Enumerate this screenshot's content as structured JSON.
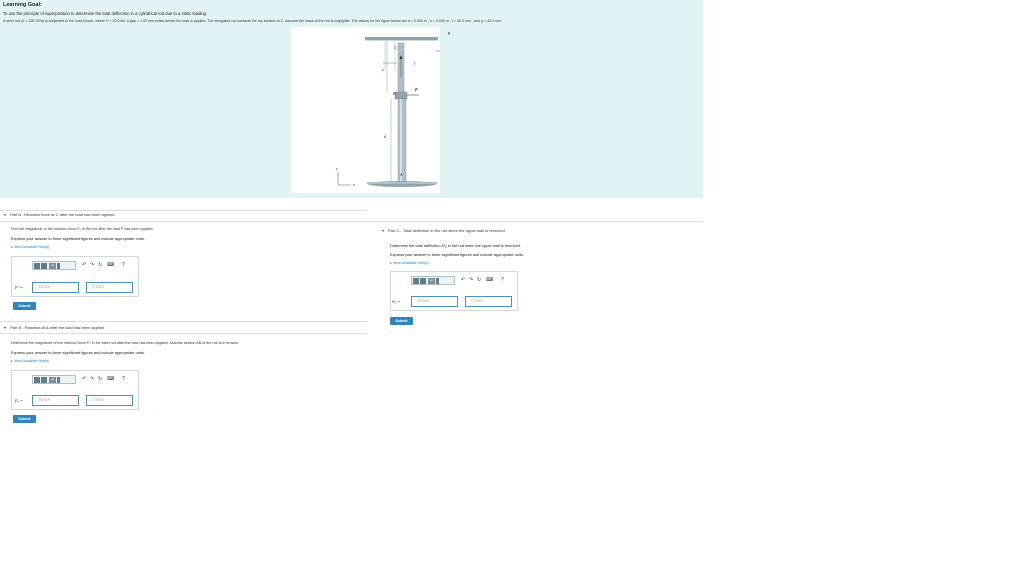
{
  "goal": {
    "title": "Learning Goal:",
    "text": "To use the principle of superposition to determine the total deflection in a cylindrical rod due to a static loading.",
    "problem_a": "A steel rod (",
    "problem_e": "E",
    "problem_b": " = 200 GPa) is subjected to the load shown, where ",
    "problem_P": "P",
    "problem_c": " = 20.0 kN. A gap ",
    "problem_d": " = 1.00 mm exists before the load is applied. The elongated rod contacts the top surface at C. Assume the mass of the rod is negligible. The values for the figure below are ",
    "problem_vals": "d = 0.900 m , e = 0.200 m , f = 50.0 mm , and g = 40.0 mm."
  },
  "figure": {
    "labels": {
      "C": "C",
      "e": "e",
      "f": "f",
      "g": "g",
      "B": "B",
      "P": "P",
      "d": "d",
      "A": "A",
      "y": "y",
      "x": "x"
    }
  },
  "partA": {
    "header": "Part A - Reaction force at C after the load has been applied",
    "question": "Find the magnitude of the reaction force Fₙ in the rod after the load P has been applied.",
    "express": "Express your answer to three significant figures and include appropriate units.",
    "hint": "View Available Hint(s)",
    "var_label": "Fᶜ =",
    "value_placeholder": "Value",
    "units_placeholder": "Units",
    "submit": "Submit"
  },
  "partB": {
    "header": "Part B - Reaction at A after the load has been applied",
    "question": "Determine the magnitude of the reaction force Fₐ in the steel rod after the load has been applied. Assume section AB of the rod is in tension.",
    "express": "Express your answer to three significant figures and include appropriate units.",
    "hint": "View Available Hint(s)",
    "var_label": "Fₐ =",
    "value_placeholder": "Value",
    "units_placeholder": "Units",
    "submit": "Submit"
  },
  "partC": {
    "header": "Part C - Total deflection in the rod when the upper wall is removed",
    "question": "Determine the total deflection δᶜₐ in the rod when the upper wall is removed.",
    "express": "Express your answer to three significant figures and include appropriate units.",
    "hint": "View Available Hint(s)",
    "var_label": "δᶜₐ =",
    "value_placeholder": "Value",
    "units_placeholder": "Units",
    "submit": "Submit"
  },
  "toolbar": {
    "templates_label": "μA",
    "help": "?",
    "undo": "↶",
    "redo": "↷",
    "reset": "↻",
    "keyboard": "⌨"
  }
}
